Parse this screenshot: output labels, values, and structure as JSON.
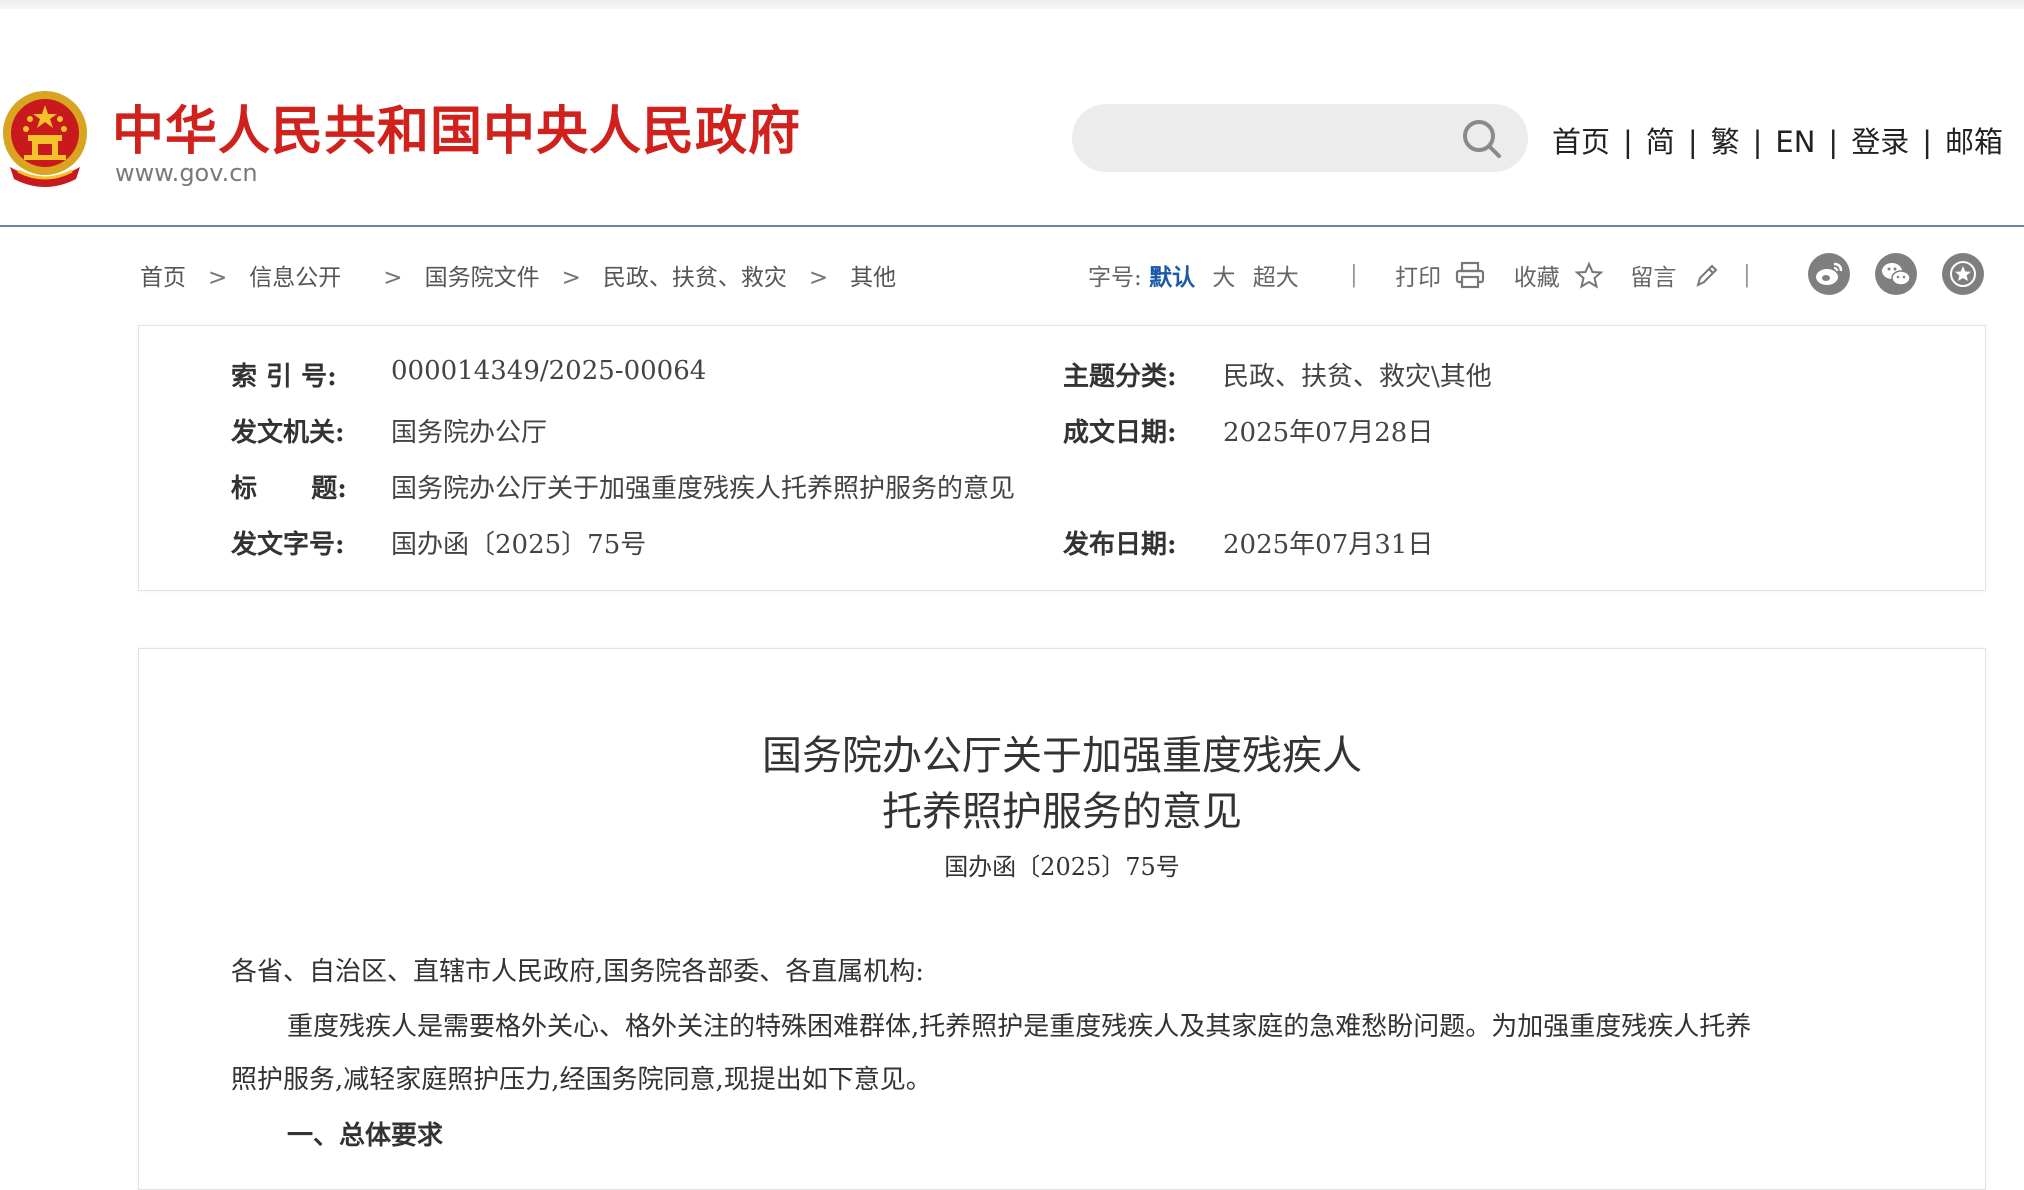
{
  "header": {
    "site_title": "中华人民共和国中央人民政府",
    "site_url": "www.gov.cn",
    "search_placeholder": "",
    "nav": [
      "首页",
      "简",
      "繁",
      "EN",
      "登录",
      "邮箱"
    ],
    "colors": {
      "brand_red": "#d0211c",
      "rule": "#6d84a8"
    }
  },
  "breadcrumb": [
    "首页",
    "信息公开",
    "国务院文件",
    "民政、扶贫、救灾",
    "其他"
  ],
  "toolbar": {
    "font_size_label": "字号:",
    "font_sizes": [
      "默认",
      "大",
      "超大"
    ],
    "print_label": "打印",
    "favorite_label": "收藏",
    "comment_label": "留言"
  },
  "share_icons": [
    "weibo-icon",
    "wechat-icon",
    "favorite-star-icon"
  ],
  "info": {
    "index_label": "索 引 号:",
    "index_value": "000014349/2025-00064",
    "topic_label": "主题分类:",
    "topic_value": "民政、扶贫、救灾\\其他",
    "issuer_label": "发文机关:",
    "issuer_value": "国务院办公厅",
    "written_label": "成文日期:",
    "written_value": "2025年07月28日",
    "title_label": "标      题:",
    "title_value": "国务院办公厅关于加强重度残疾人托养照护服务的意见",
    "docno_label": "发文字号:",
    "docno_value": "国办函〔2025〕75号",
    "published_label": "发布日期:",
    "published_value": "2025年07月31日"
  },
  "article": {
    "title_line1": "国务院办公厅关于加强重度残疾人",
    "title_line2": "托养照护服务的意见",
    "doc_number": "国办函〔2025〕75号",
    "salutation": "各省、自治区、直辖市人民政府,国务院各部委、各直属机构:",
    "para1_line1": "重度残疾人是需要格外关心、格外关注的特殊困难群体,托养照护是重度残疾人及其家庭的急难愁盼问题。为加强重度残疾人托养",
    "para1_line2": "照护服务,减轻家庭照护压力,经国务院同意,现提出如下意见。",
    "section1": "一、总体要求"
  }
}
